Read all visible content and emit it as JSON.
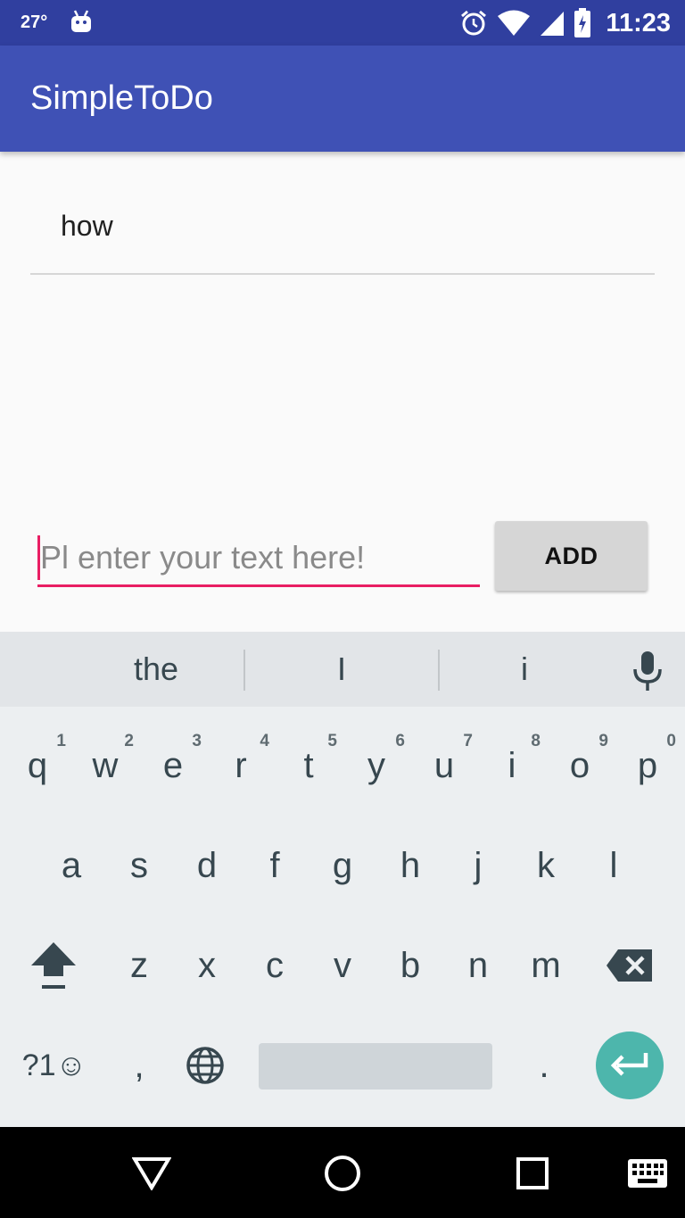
{
  "status_bar": {
    "temperature": "27°",
    "time": "11:23"
  },
  "app_bar": {
    "title": "SimpleToDo"
  },
  "todo_items": [
    "how"
  ],
  "input": {
    "placeholder": "Pl enter your text here!",
    "value": ""
  },
  "add_button_label": "ADD",
  "accent_color": "#e91e63",
  "primary_color": "#3f51b5",
  "keyboard": {
    "suggestions": [
      "the",
      "I",
      "i"
    ],
    "row1": [
      {
        "key": "q",
        "hint": "1"
      },
      {
        "key": "w",
        "hint": "2"
      },
      {
        "key": "e",
        "hint": "3"
      },
      {
        "key": "r",
        "hint": "4"
      },
      {
        "key": "t",
        "hint": "5"
      },
      {
        "key": "y",
        "hint": "6"
      },
      {
        "key": "u",
        "hint": "7"
      },
      {
        "key": "i",
        "hint": "8"
      },
      {
        "key": "o",
        "hint": "9"
      },
      {
        "key": "p",
        "hint": "0"
      }
    ],
    "row2": [
      "a",
      "s",
      "d",
      "f",
      "g",
      "h",
      "j",
      "k",
      "l"
    ],
    "row3": [
      "z",
      "x",
      "c",
      "v",
      "b",
      "n",
      "m"
    ],
    "symbols_label": "?1☺",
    "comma": ",",
    "period": "."
  }
}
